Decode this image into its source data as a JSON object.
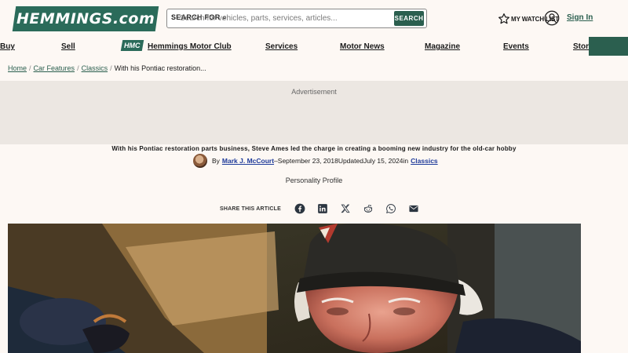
{
  "header": {
    "logo_text": "HEMMINGS.com",
    "search_label": "SEARCH FOR",
    "search_placeholder": "Search for vehicles, parts, services, articles...",
    "search_button": "SEARCH",
    "watchlist_label": "MY WATCH LIST",
    "signin_label": "Sign In"
  },
  "nav": {
    "items": [
      {
        "label": "Buy"
      },
      {
        "label": "Sell"
      },
      {
        "label": "Hemmings Motor Club",
        "badge": "HMC"
      },
      {
        "label": "Services"
      },
      {
        "label": "Motor News"
      },
      {
        "label": "Magazine"
      },
      {
        "label": "Events"
      },
      {
        "label": "Store"
      }
    ]
  },
  "breadcrumb": {
    "items": [
      "Home",
      "Car Features",
      "Classics"
    ],
    "separator": "/",
    "current": "With his Pontiac restoration..."
  },
  "ad": {
    "label": "Advertisement"
  },
  "article": {
    "dek": "With his Pontiac restoration parts business, Steve Ames led the charge in creating a booming new industry for the old-car hobby",
    "by": "By",
    "author": "Mark J. McCourt",
    "published": "–September 23, 2018",
    "updated_label": "Updated",
    "updated": "July 15, 2024",
    "in_label": "in",
    "category": "Classics",
    "section": "Personality Profile",
    "share_label": "SHARE THIS ARTICLE",
    "share_icons": [
      "facebook-icon",
      "linkedin-icon",
      "x-icon",
      "reddit-icon",
      "whatsapp-icon",
      "email-icon"
    ]
  },
  "colors": {
    "brand_green": "#2b6b5a",
    "button_green": "#2b5f4f",
    "background": "#fdf8f4",
    "ad_background": "#ece7e2",
    "link_blue": "#1f3b9a"
  }
}
